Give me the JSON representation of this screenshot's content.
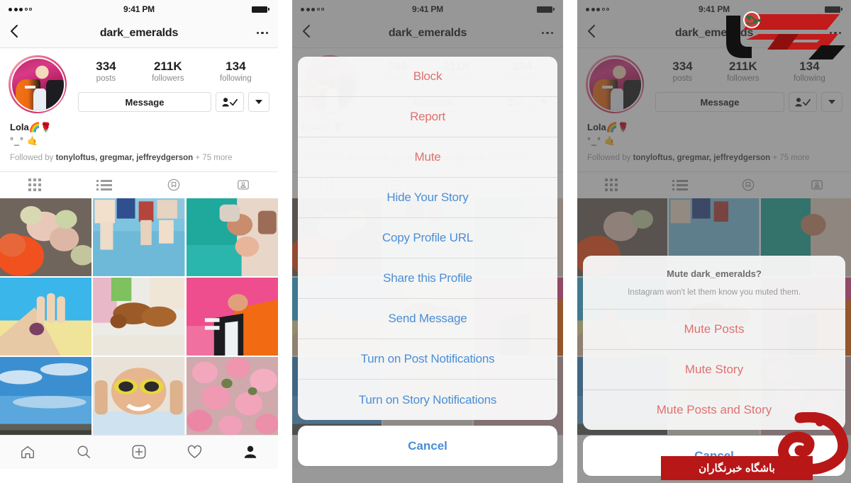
{
  "status_bar": {
    "signal_filled": 3,
    "signal_empty": 2,
    "time": "9:41 PM",
    "battery": "full"
  },
  "nav": {
    "back_icon": "chevron-left-icon",
    "title": "dark_emeralds",
    "more_icon": "ellipsis-icon"
  },
  "profile": {
    "stats": [
      {
        "num": "334",
        "label": "posts"
      },
      {
        "num": "211K",
        "label": "followers"
      },
      {
        "num": "134",
        "label": "following"
      }
    ],
    "message_button": "Message",
    "follow_icon": "person-check-icon",
    "caret_icon": "chevron-down-icon",
    "bio_name": "Lola🌈🌹",
    "bio_line2": "°_° 🤙",
    "followed_prefix": "Followed by ",
    "followed_names": "tonyloftus, gregmar, jeffreydgerson",
    "followed_suffix": " + 75 more"
  },
  "tabs": [
    {
      "name": "grid-tab",
      "icon": "grid-icon"
    },
    {
      "name": "list-tab",
      "icon": "list-icon"
    },
    {
      "name": "saved-tab",
      "icon": "bookmark-circle-icon"
    },
    {
      "name": "tagged-tab",
      "icon": "tagged-photos-icon"
    }
  ],
  "photo_grid": [
    {
      "alt": "orange-roses-bouquet-on-asphalt"
    },
    {
      "alt": "friends-sitting-on-blue-steps"
    },
    {
      "alt": "friends-lying-on-teal-blanket"
    },
    {
      "alt": "hand-with-bracelet-blue-yellow"
    },
    {
      "alt": "two-puppies-playing"
    },
    {
      "alt": "person-orange-hoodie-pink-wall"
    },
    {
      "alt": "beach-sky-clouds"
    },
    {
      "alt": "kid-with-yellow-sunglasses"
    },
    {
      "alt": "pink-cherry-blossoms"
    }
  ],
  "bottom_nav": [
    {
      "name": "home-icon",
      "active": false
    },
    {
      "name": "search-icon",
      "active": false
    },
    {
      "name": "add-post-icon",
      "active": false
    },
    {
      "name": "activity-heart-icon",
      "active": false
    },
    {
      "name": "profile-icon",
      "active": true
    }
  ],
  "action_sheet": {
    "items": [
      {
        "label": "Block",
        "style": "destructive"
      },
      {
        "label": "Report",
        "style": "destructive"
      },
      {
        "label": "Mute",
        "style": "destructive"
      },
      {
        "label": "Hide Your Story",
        "style": "default"
      },
      {
        "label": "Copy Profile URL",
        "style": "default"
      },
      {
        "label": "Share this Profile",
        "style": "default"
      },
      {
        "label": "Send Message",
        "style": "default"
      },
      {
        "label": "Turn on Post Notifications",
        "style": "default"
      },
      {
        "label": "Turn on Story Notifications",
        "style": "default"
      }
    ],
    "cancel_label": "Cancel"
  },
  "mute_alert": {
    "title": "Mute dark_emeralds?",
    "subtitle": "Instagram won't let them know you muted them.",
    "items": [
      {
        "label": "Mute Posts"
      },
      {
        "label": "Mute Story"
      },
      {
        "label": "Mute Posts and Story"
      }
    ],
    "cancel_label": "Cancel"
  },
  "watermarks": {
    "top_right_logo": "dana-news-logo-with-globe",
    "bottom_right_logo": "khabarnegaran-kh-logo",
    "bottom_right_text": "باشگاه خبرنگاران"
  },
  "colors": {
    "destructive": "#e07070",
    "action_blue": "#4a8ed6",
    "story_ring": "#d6337a",
    "watermark_red": "#b81717",
    "dim_overlay": "#464646"
  }
}
